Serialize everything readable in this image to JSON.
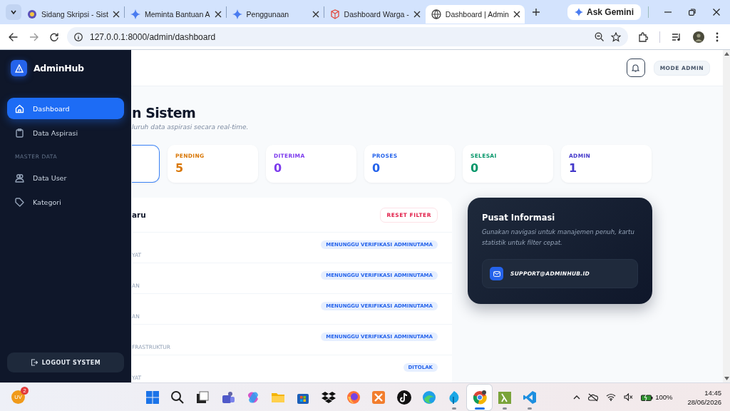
{
  "browser": {
    "tabs": [
      {
        "title": "Sidang Skripsi - Sist",
        "selected": false
      },
      {
        "title": "Meminta Bantuan A",
        "selected": false
      },
      {
        "title": "Penggunaan",
        "selected": false
      },
      {
        "title": "Dashboard Warga -",
        "selected": false
      },
      {
        "title": "Dashboard | Admin",
        "selected": true
      }
    ],
    "ask_gemini": "Ask Gemini",
    "url": "127.0.0.1:8000/admin/dashboard"
  },
  "sidebar": {
    "brand": "AdminHub",
    "items": [
      {
        "kind": "link",
        "label": "Dashboard",
        "selected": true
      },
      {
        "kind": "link",
        "label": "Data Aspirasi",
        "selected": false
      },
      {
        "kind": "heading",
        "label": "MASTER DATA"
      },
      {
        "kind": "link",
        "label": "Data User",
        "selected": false
      },
      {
        "kind": "link",
        "label": "Kategori",
        "selected": false
      }
    ],
    "logout": "LOGOUT SYSTEM"
  },
  "header": {
    "mode_badge": "MODE ADMIN"
  },
  "page": {
    "title": "n Sistem",
    "subtitle": "luruh data aspirasi secara real-time."
  },
  "stat_cards": [
    {
      "selected": true
    },
    {
      "label": "PENDING",
      "value": "5",
      "color": "#d97706",
      "selected": false
    },
    {
      "label": "DITERIMA",
      "value": "0",
      "color": "#7c3aed",
      "selected": false
    },
    {
      "label": "PROSES",
      "value": "0",
      "color": "#2563eb",
      "selected": false
    },
    {
      "label": "SELESAI",
      "value": "0",
      "color": "#059669",
      "selected": false
    },
    {
      "label": "ADMIN",
      "value": "1",
      "color": "#4338ca",
      "selected": false
    }
  ],
  "recent_table": {
    "title": "aru",
    "reset_button": "RESET FILTER",
    "rows": [
      {
        "column_1": "YAT",
        "status": "MENUNGGU VERIFIKASI ADMINUTAMA"
      },
      {
        "column_1": "AN",
        "status": "MENUNGGU VERIFIKASI ADMINUTAMA"
      },
      {
        "column_1": "AN",
        "status": "MENUNGGU VERIFIKASI ADMINUTAMA"
      },
      {
        "column_1": "FRASTRUKTUR",
        "status": "MENUNGGU VERIFIKASI ADMINUTAMA"
      },
      {
        "column_1": "YAT",
        "status": "DITOLAK"
      }
    ]
  },
  "info_card": {
    "title": "Pusat Informasi",
    "text": "Gunakan navigasi untuk manajemen penuh, kartu statistik untuk filter cepat.",
    "email": "SUPPORT@ADMINHUB.ID"
  },
  "taskbar": {
    "user_initials": "UV",
    "notification_count": "2",
    "apps": [
      {
        "running": false,
        "selected": false
      },
      {
        "running": false,
        "selected": false
      },
      {
        "running": false,
        "selected": false
      },
      {
        "running": false,
        "selected": false
      },
      {
        "running": false,
        "selected": false
      },
      {
        "running": false,
        "selected": false
      },
      {
        "running": false,
        "selected": false
      },
      {
        "running": false,
        "selected": false
      },
      {
        "running": false,
        "selected": false
      },
      {
        "running": false,
        "selected": false
      },
      {
        "running": false,
        "selected": false
      },
      {
        "running": false,
        "selected": false
      },
      {
        "running": true,
        "selected": false
      },
      {
        "running": true,
        "selected": true
      },
      {
        "running": true,
        "selected": false
      },
      {
        "running": true,
        "selected": false
      }
    ],
    "battery": "100%",
    "time": "14:45",
    "date": "28/06/2026"
  }
}
